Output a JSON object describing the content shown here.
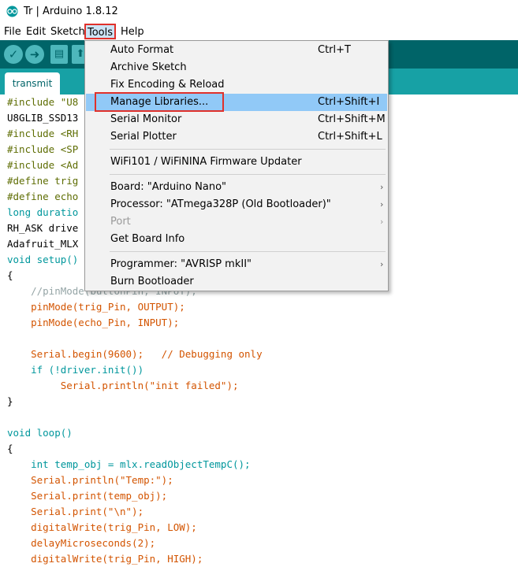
{
  "window": {
    "title": "Tr | Arduino 1.8.12"
  },
  "menubar": {
    "file": "File",
    "edit": "Edit",
    "sketch": "Sketch",
    "tools": "Tools",
    "help": "Help"
  },
  "toolbar": {
    "verify": "✓",
    "upload": "➜",
    "new": "▤",
    "open": "⬆"
  },
  "tabs": [
    {
      "label": "transmit"
    }
  ],
  "code_lines": [
    {
      "text": "#include \"U8"
    },
    {
      "text": "U8GLIB_SSD13"
    },
    {
      "text": "#include <RH"
    },
    {
      "text": "#include <SP"
    },
    {
      "text": "#include <Ad"
    },
    {
      "text": "#define trig"
    },
    {
      "text": "#define echo"
    },
    {
      "text": "long duratio"
    },
    {
      "text": "RH_ASK drive"
    },
    {
      "text": "Adafruit_MLX"
    },
    {
      "text": "void setup()"
    },
    {
      "text": "{"
    },
    {
      "text": "    //pinMode(buttonPin, INPUT);"
    },
    {
      "text": "    pinMode(trig_Pin, OUTPUT);"
    },
    {
      "text": "    pinMode(echo_Pin, INPUT);"
    },
    {
      "text": ""
    },
    {
      "text": "    Serial.begin(9600);   // Debugging only"
    },
    {
      "text": "    if (!driver.init())"
    },
    {
      "text": "         Serial.println(\"init failed\");"
    },
    {
      "text": "}"
    },
    {
      "text": ""
    },
    {
      "text": "void loop()"
    },
    {
      "text": "{"
    },
    {
      "text": "    int temp_obj = mlx.readObjectTempC();"
    },
    {
      "text": "    Serial.println(\"Temp:\");"
    },
    {
      "text": "    Serial.print(temp_obj);"
    },
    {
      "text": "    Serial.print(\"\\n\");"
    },
    {
      "text": "    digitalWrite(trig_Pin, LOW);"
    },
    {
      "text": "    delayMicroseconds(2);"
    },
    {
      "text": "    digitalWrite(trig_Pin, HIGH);"
    }
  ],
  "tools_menu": {
    "items": [
      {
        "label": "Auto Format",
        "shortcut": "Ctrl+T"
      },
      {
        "label": "Archive Sketch",
        "shortcut": ""
      },
      {
        "label": "Fix Encoding & Reload",
        "shortcut": ""
      },
      {
        "label": "Manage Libraries...",
        "shortcut": "Ctrl+Shift+I"
      },
      {
        "label": "Serial Monitor",
        "shortcut": "Ctrl+Shift+M"
      },
      {
        "label": "Serial Plotter",
        "shortcut": "Ctrl+Shift+L"
      },
      {
        "label": "WiFi101 / WiFiNINA Firmware Updater",
        "shortcut": ""
      },
      {
        "label": "Board: \"Arduino Nano\"",
        "shortcut": ""
      },
      {
        "label": "Processor: \"ATmega328P (Old Bootloader)\"",
        "shortcut": ""
      },
      {
        "label": "Port",
        "shortcut": ""
      },
      {
        "label": "Get Board Info",
        "shortcut": ""
      },
      {
        "label": "Programmer: \"AVRISP mkII\"",
        "shortcut": ""
      },
      {
        "label": "Burn Bootloader",
        "shortcut": ""
      }
    ],
    "submenu_arrow": "›"
  },
  "colors": {
    "toolbar": "#006468",
    "tabbar": "#17a1a5",
    "highlight": "#91c9f7",
    "annotation": "#e0312b"
  }
}
